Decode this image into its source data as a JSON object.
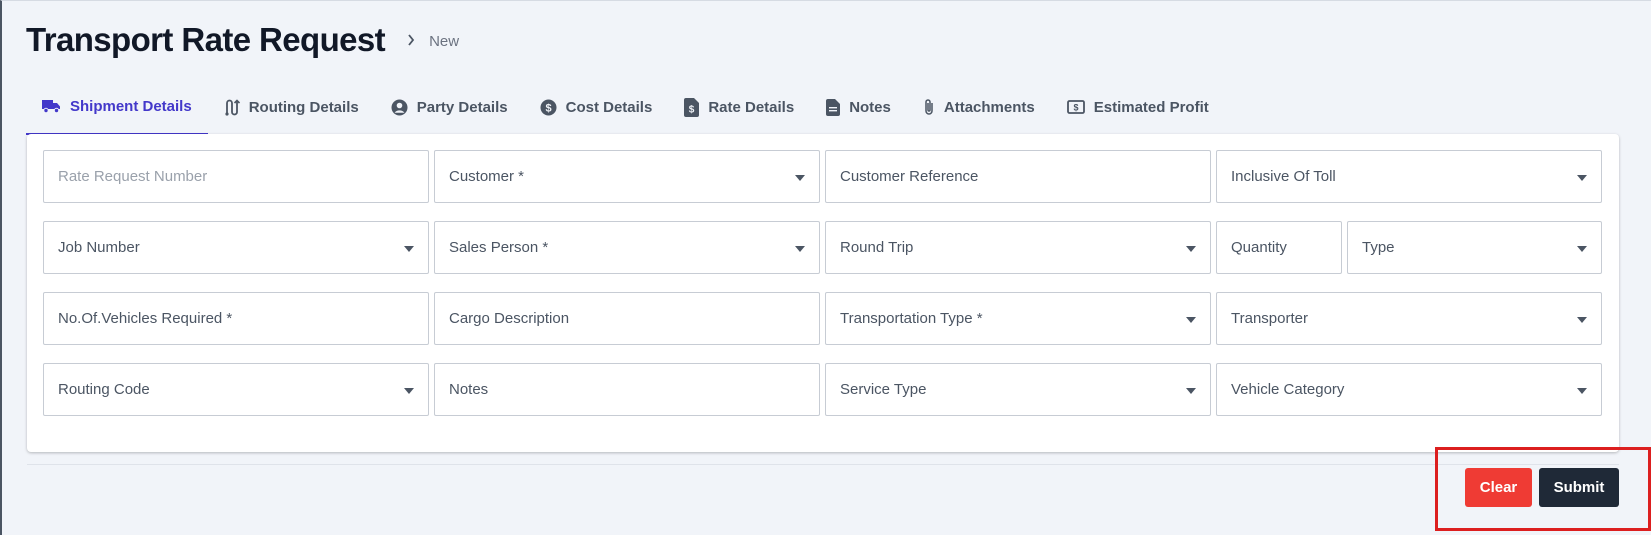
{
  "header": {
    "title": "Transport Rate Request",
    "breadcrumb_current": "New"
  },
  "tabs": [
    {
      "label": "Shipment Details",
      "icon": "truck-icon",
      "active": true
    },
    {
      "label": "Routing Details",
      "icon": "route-icon",
      "active": false
    },
    {
      "label": "Party Details",
      "icon": "user-circle-icon",
      "active": false
    },
    {
      "label": "Cost Details",
      "icon": "dollar-circle-icon",
      "active": false
    },
    {
      "label": "Rate Details",
      "icon": "invoice-icon",
      "active": false
    },
    {
      "label": "Notes",
      "icon": "document-icon",
      "active": false
    },
    {
      "label": "Attachments",
      "icon": "paperclip-icon",
      "active": false
    },
    {
      "label": "Estimated Profit",
      "icon": "cash-icon",
      "active": false
    }
  ],
  "form": {
    "rate_request_number": "Rate Request Number",
    "customer": "Customer *",
    "customer_reference": "Customer Reference",
    "inclusive_of_toll": "Inclusive Of Toll",
    "job_number": "Job Number",
    "sales_person": "Sales Person *",
    "round_trip": "Round Trip",
    "quantity": "Quantity",
    "type": "Type",
    "vehicles_required": "No.Of.Vehicles Required *",
    "cargo_description": "Cargo Description",
    "transportation_type": "Transportation Type *",
    "transporter": "Transporter",
    "routing_code": "Routing Code",
    "notes": "Notes",
    "service_type": "Service Type",
    "vehicle_category": "Vehicle Category"
  },
  "actions": {
    "clear_label": "Clear",
    "submit_label": "Submit"
  },
  "colors": {
    "accent": "#4338ca",
    "clear_button": "#ef3b34",
    "submit_button": "#1f2937",
    "highlight_box": "#dc1f1f"
  }
}
